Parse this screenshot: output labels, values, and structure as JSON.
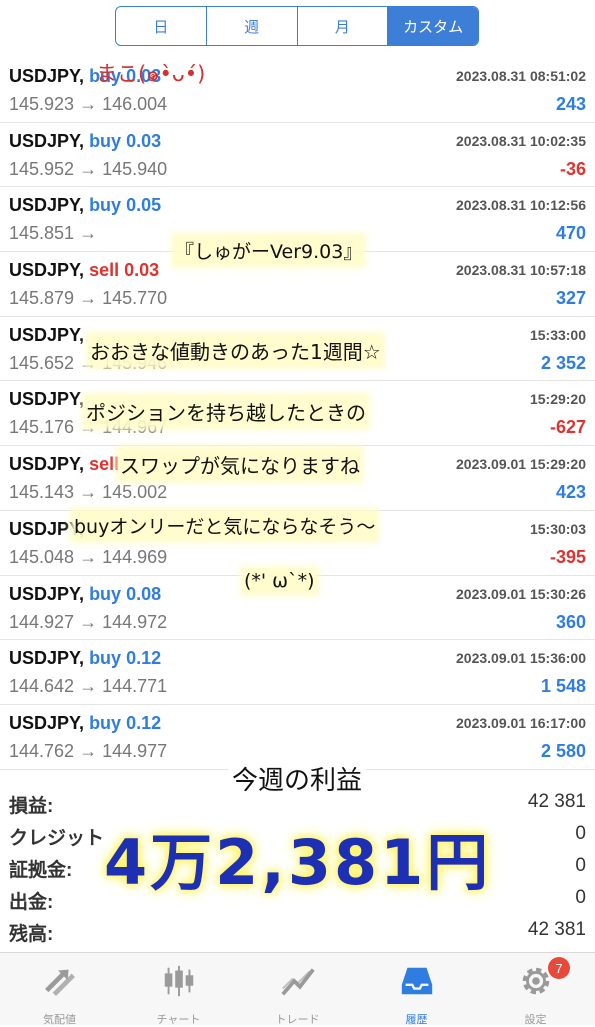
{
  "period_tabs": [
    "日",
    "週",
    "月",
    "カスタム"
  ],
  "selected_period": "カスタム",
  "trades": [
    {
      "symbol": "USDJPY,",
      "side": "buy",
      "lots": "0.03",
      "time": "2023.08.31 08:51:02",
      "open": "145.923",
      "arrow": "→",
      "close": "146.004",
      "profit": "243"
    },
    {
      "symbol": "USDJPY,",
      "side": "buy",
      "lots": "0.03",
      "time": "2023.08.31 10:02:35",
      "open": "145.952",
      "arrow": "→",
      "close": "145.940",
      "profit": "-36"
    },
    {
      "symbol": "USDJPY,",
      "side": "buy",
      "lots": "0.05",
      "time": "2023.08.31 10:12:56",
      "open": "145.851",
      "arrow": "→",
      "close": "",
      "profit": "470"
    },
    {
      "symbol": "USDJPY,",
      "side": "sell",
      "lots": "0.03",
      "time": "2023.08.31 10:57:18",
      "open": "145.879",
      "arrow": "→",
      "close": "145.770",
      "profit": "327"
    },
    {
      "symbol": "USDJPY,",
      "side": "",
      "lots": "",
      "time": "15:33:00",
      "open": "145.652",
      "arrow": "→",
      "close": "145.946",
      "profit": "2 352"
    },
    {
      "symbol": "USDJPY,",
      "side": "",
      "lots": "",
      "time": "15:29:20",
      "open": "145.176",
      "arrow": "→",
      "close": "144.967",
      "profit": "-627"
    },
    {
      "symbol": "USDJPY,",
      "side": "sell",
      "lots": "",
      "time": "2023.09.01 15:29:20",
      "open": "145.143",
      "arrow": "→",
      "close": "145.002",
      "profit": "423"
    },
    {
      "symbol": "USDJPY,",
      "side": "",
      "lots": "",
      "time": "15:30:03",
      "open": "145.048",
      "arrow": "→",
      "close": "144.969",
      "profit": "-395"
    },
    {
      "symbol": "USDJPY,",
      "side": "buy",
      "lots": "0.08",
      "time": "2023.09.01 15:30:26",
      "open": "144.927",
      "arrow": "→",
      "close": "144.972",
      "profit": "360"
    },
    {
      "symbol": "USDJPY,",
      "side": "buy",
      "lots": "0.12",
      "time": "2023.09.01 15:36:00",
      "open": "144.642",
      "arrow": "→",
      "close": "144.771",
      "profit": "1 548"
    },
    {
      "symbol": "USDJPY,",
      "side": "buy",
      "lots": "0.12",
      "time": "2023.09.01 16:17:00",
      "open": "144.762",
      "arrow": "→",
      "close": "144.977",
      "profit": "2 580"
    }
  ],
  "summary": [
    {
      "label": "損益:",
      "value": "42 381"
    },
    {
      "label": "クレジット",
      "value": "0"
    },
    {
      "label": "証拠金:",
      "value": "0"
    },
    {
      "label": "出金:",
      "value": "0"
    },
    {
      "label": "残高:",
      "value": "42 381"
    }
  ],
  "tabbar": [
    {
      "label": "気配値",
      "icon": "quotes-arrows-icon"
    },
    {
      "label": "チャート",
      "icon": "candlestick-chart-icon"
    },
    {
      "label": "トレード",
      "icon": "trade-chart-icon"
    },
    {
      "label": "履歴",
      "icon": "history-inbox-icon"
    },
    {
      "label": "設定",
      "icon": "gear-icon"
    }
  ],
  "selected_tab": "履歴",
  "settings_badge": "7",
  "handwritten": {
    "mako": "まこ(๑•̀ᴗ•́)",
    "title": "『しゅがーVer9.03』",
    "line1": "おおきな値動きのあった1週間☆",
    "line2": "ポジションを持ち越したときの",
    "line3": "スワップが気になりますね",
    "line4": "buyオンリーだと気にならなそう〜",
    "line5": "(*' ω`*)",
    "week_profit": "今週の利益",
    "total": "4万2,381円"
  },
  "colors": {
    "accent": "#2f7de1",
    "loss": "#e0332f",
    "segment": "#3d7fd6",
    "total_ink": "#1d2fb3",
    "highlight": "#fff46b"
  }
}
